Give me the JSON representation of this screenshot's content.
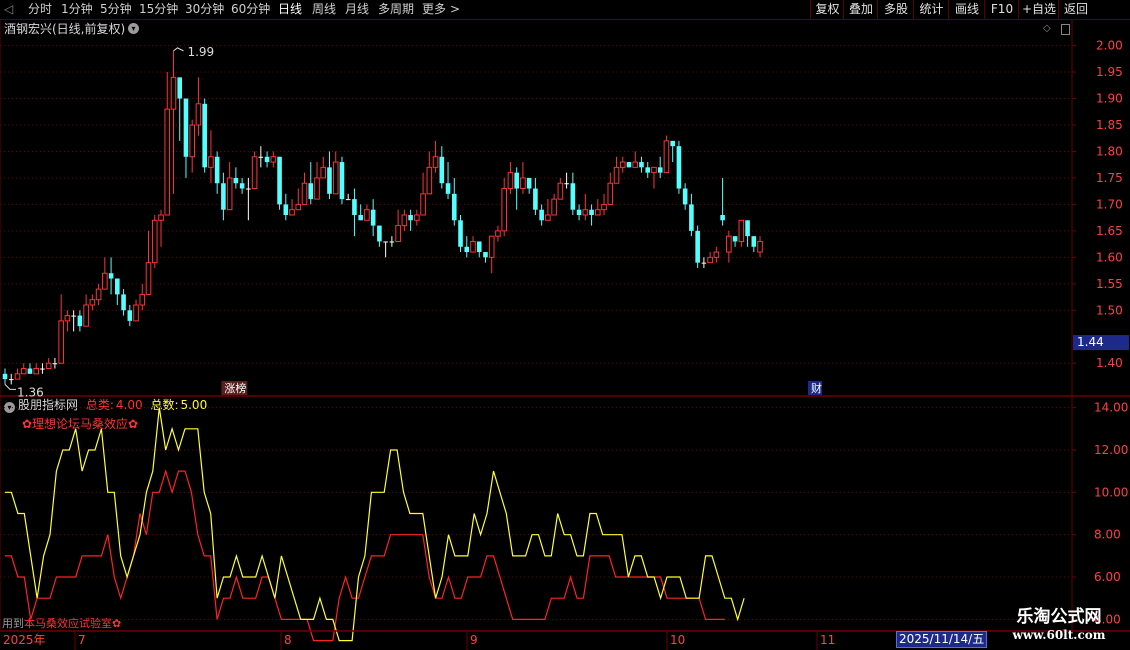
{
  "toolbar": {
    "periods": [
      "分时",
      "1分钟",
      "5分钟",
      "15分钟",
      "30分钟",
      "60分钟",
      "日线",
      "周线",
      "月线",
      "多周期",
      "更多"
    ],
    "active_period": "日线",
    "more_arrow": ">",
    "right_buttons": [
      "复权",
      "叠加",
      "多股",
      "统计",
      "画线",
      "F10",
      "+自选",
      "返回"
    ]
  },
  "main_chart": {
    "title": "酒钢宏兴(日线,前复权)",
    "high_label": "1.99",
    "low_label": "1.36",
    "current_price": "1.44",
    "y_ticks": [
      "2.00",
      "1.95",
      "1.90",
      "1.85",
      "1.80",
      "1.75",
      "1.70",
      "1.65",
      "1.60",
      "1.55",
      "1.50",
      "1.40"
    ],
    "markers": [
      {
        "label": "涨榜"
      },
      {
        "label": "财"
      }
    ],
    "colors": {
      "up": "#ff3333",
      "down": "#54ffff",
      "flat": "#ffffff",
      "grid": "#6e0000"
    }
  },
  "indicator": {
    "name": "股朋指标网",
    "label1": "总类:",
    "value1": "4.00",
    "label2": "总数:",
    "value2": "5.00",
    "caption": "✿理想论坛马桑效应✿",
    "y_ticks": [
      "14.00",
      "12.00",
      "10.00",
      "8.00",
      "6.00",
      "4.00"
    ],
    "colors": {
      "yellow": "#ffff33",
      "red": "#ff2222"
    }
  },
  "footer": {
    "bottom_left_gray": "用到",
    "bottom_left_red": "本马桑效应试验室✿",
    "year_label": "2025年",
    "month_labels": [
      "7",
      "8",
      "9",
      "10",
      "11"
    ],
    "date_box": "2025/11/14/五"
  },
  "watermark": {
    "title": "乐淘公式网",
    "url": "www.60lt.com"
  },
  "chart_data": [
    {
      "type": "candlestick",
      "title": "酒钢宏兴(日线,前复权)",
      "ylim": [
        1.34,
        2.02
      ],
      "annotations": {
        "high": 1.99,
        "low": 1.36,
        "last": 1.44
      },
      "candles": [
        [
          1.38,
          1.37,
          1.39,
          1.36
        ],
        [
          1.37,
          1.37,
          1.38,
          1.36
        ],
        [
          1.37,
          1.38,
          1.39,
          1.37
        ],
        [
          1.38,
          1.39,
          1.4,
          1.38
        ],
        [
          1.39,
          1.38,
          1.4,
          1.38
        ],
        [
          1.38,
          1.39,
          1.4,
          1.38
        ],
        [
          1.39,
          1.39,
          1.4,
          1.38
        ],
        [
          1.39,
          1.4,
          1.41,
          1.39
        ],
        [
          1.4,
          1.4,
          1.41,
          1.39
        ],
        [
          1.4,
          1.48,
          1.53,
          1.4
        ],
        [
          1.48,
          1.49,
          1.5,
          1.46
        ],
        [
          1.49,
          1.49,
          1.5,
          1.46
        ],
        [
          1.49,
          1.47,
          1.5,
          1.46
        ],
        [
          1.47,
          1.51,
          1.53,
          1.47
        ],
        [
          1.51,
          1.52,
          1.53,
          1.5
        ],
        [
          1.52,
          1.54,
          1.55,
          1.51
        ],
        [
          1.54,
          1.57,
          1.6,
          1.54
        ],
        [
          1.57,
          1.56,
          1.6,
          1.53
        ],
        [
          1.56,
          1.53,
          1.56,
          1.51
        ],
        [
          1.53,
          1.5,
          1.54,
          1.49
        ],
        [
          1.5,
          1.48,
          1.51,
          1.47
        ],
        [
          1.48,
          1.51,
          1.52,
          1.48
        ],
        [
          1.51,
          1.53,
          1.55,
          1.5
        ],
        [
          1.53,
          1.59,
          1.65,
          1.53
        ],
        [
          1.59,
          1.67,
          1.68,
          1.58
        ],
        [
          1.67,
          1.68,
          1.69,
          1.62
        ],
        [
          1.68,
          1.88,
          1.95,
          1.68
        ],
        [
          1.88,
          1.94,
          1.99,
          1.72
        ],
        [
          1.94,
          1.9,
          1.92,
          1.82
        ],
        [
          1.9,
          1.79,
          1.85,
          1.75
        ],
        [
          1.79,
          1.85,
          1.86,
          1.76
        ],
        [
          1.85,
          1.89,
          1.94,
          1.83
        ],
        [
          1.89,
          1.77,
          1.9,
          1.76
        ],
        [
          1.77,
          1.79,
          1.84,
          1.74
        ],
        [
          1.79,
          1.74,
          1.8,
          1.72
        ],
        [
          1.74,
          1.69,
          1.76,
          1.67
        ],
        [
          1.69,
          1.75,
          1.78,
          1.69
        ],
        [
          1.75,
          1.74,
          1.77,
          1.73
        ],
        [
          1.74,
          1.73,
          1.75,
          1.72
        ],
        [
          1.73,
          1.73,
          1.75,
          1.67
        ],
        [
          1.73,
          1.79,
          1.8,
          1.73
        ],
        [
          1.79,
          1.79,
          1.81,
          1.77
        ],
        [
          1.79,
          1.78,
          1.8,
          1.77
        ],
        [
          1.78,
          1.79,
          1.8,
          1.77
        ],
        [
          1.79,
          1.7,
          1.79,
          1.69
        ],
        [
          1.7,
          1.68,
          1.72,
          1.67
        ],
        [
          1.68,
          1.69,
          1.71,
          1.68
        ],
        [
          1.69,
          1.7,
          1.73,
          1.69
        ],
        [
          1.7,
          1.74,
          1.76,
          1.7
        ],
        [
          1.74,
          1.71,
          1.78,
          1.7
        ],
        [
          1.71,
          1.75,
          1.78,
          1.71
        ],
        [
          1.75,
          1.77,
          1.79,
          1.75
        ],
        [
          1.77,
          1.72,
          1.8,
          1.71
        ],
        [
          1.72,
          1.78,
          1.8,
          1.72
        ],
        [
          1.78,
          1.71,
          1.79,
          1.7
        ],
        [
          1.71,
          1.71,
          1.72,
          1.71
        ],
        [
          1.71,
          1.68,
          1.73,
          1.64
        ],
        [
          1.68,
          1.67,
          1.7,
          1.67
        ],
        [
          1.67,
          1.69,
          1.7,
          1.68
        ],
        [
          1.69,
          1.66,
          1.71,
          1.64
        ],
        [
          1.66,
          1.63,
          1.66,
          1.62
        ],
        [
          1.63,
          1.63,
          1.63,
          1.6
        ],
        [
          1.63,
          1.63,
          1.64,
          1.62
        ],
        [
          1.63,
          1.66,
          1.69,
          1.63
        ],
        [
          1.66,
          1.68,
          1.69,
          1.65
        ],
        [
          1.68,
          1.67,
          1.69,
          1.65
        ],
        [
          1.67,
          1.68,
          1.69,
          1.66
        ],
        [
          1.68,
          1.72,
          1.76,
          1.68
        ],
        [
          1.72,
          1.77,
          1.8,
          1.72
        ],
        [
          1.77,
          1.79,
          1.82,
          1.76
        ],
        [
          1.79,
          1.74,
          1.81,
          1.73
        ],
        [
          1.74,
          1.72,
          1.78,
          1.71
        ],
        [
          1.72,
          1.67,
          1.75,
          1.66
        ],
        [
          1.67,
          1.62,
          1.68,
          1.61
        ],
        [
          1.62,
          1.61,
          1.64,
          1.6
        ],
        [
          1.61,
          1.63,
          1.64,
          1.61
        ],
        [
          1.63,
          1.61,
          1.63,
          1.6
        ],
        [
          1.61,
          1.6,
          1.61,
          1.59
        ],
        [
          1.6,
          1.64,
          1.64,
          1.57
        ],
        [
          1.64,
          1.65,
          1.66,
          1.63
        ],
        [
          1.65,
          1.73,
          1.75,
          1.64
        ],
        [
          1.73,
          1.76,
          1.78,
          1.72
        ],
        [
          1.76,
          1.73,
          1.77,
          1.69
        ],
        [
          1.73,
          1.75,
          1.78,
          1.72
        ],
        [
          1.75,
          1.73,
          1.75,
          1.72
        ],
        [
          1.73,
          1.69,
          1.75,
          1.68
        ],
        [
          1.69,
          1.67,
          1.7,
          1.66
        ],
        [
          1.67,
          1.68,
          1.71,
          1.67
        ],
        [
          1.68,
          1.71,
          1.72,
          1.68
        ],
        [
          1.71,
          1.74,
          1.75,
          1.71
        ],
        [
          1.74,
          1.74,
          1.76,
          1.73
        ],
        [
          1.74,
          1.69,
          1.76,
          1.68
        ],
        [
          1.69,
          1.68,
          1.7,
          1.67
        ],
        [
          1.68,
          1.69,
          1.72,
          1.67
        ],
        [
          1.69,
          1.68,
          1.7,
          1.66
        ],
        [
          1.68,
          1.69,
          1.71,
          1.68
        ],
        [
          1.69,
          1.7,
          1.72,
          1.68
        ],
        [
          1.7,
          1.74,
          1.76,
          1.7
        ],
        [
          1.74,
          1.77,
          1.79,
          1.74
        ],
        [
          1.77,
          1.78,
          1.79,
          1.76
        ],
        [
          1.78,
          1.77,
          1.78,
          1.77
        ],
        [
          1.77,
          1.78,
          1.8,
          1.77
        ],
        [
          1.78,
          1.77,
          1.79,
          1.76
        ],
        [
          1.77,
          1.76,
          1.78,
          1.75
        ],
        [
          1.76,
          1.77,
          1.77,
          1.73
        ],
        [
          1.77,
          1.76,
          1.79,
          1.75
        ],
        [
          1.76,
          1.82,
          1.83,
          1.76
        ],
        [
          1.82,
          1.81,
          1.82,
          1.78
        ],
        [
          1.81,
          1.73,
          1.82,
          1.72
        ],
        [
          1.73,
          1.7,
          1.74,
          1.69
        ],
        [
          1.7,
          1.65,
          1.72,
          1.64
        ],
        [
          1.65,
          1.59,
          1.66,
          1.58
        ],
        [
          1.59,
          1.59,
          1.6,
          1.58
        ],
        [
          1.59,
          1.6,
          1.61,
          1.59
        ],
        [
          1.6,
          1.61,
          1.62,
          1.59
        ],
        [
          1.68,
          1.67,
          1.75,
          1.66
        ],
        [
          1.61,
          1.64,
          1.65,
          1.59
        ],
        [
          1.64,
          1.63,
          1.64,
          1.62
        ],
        [
          1.63,
          1.67,
          1.67,
          1.62
        ],
        [
          1.67,
          1.64,
          1.67,
          1.62
        ],
        [
          1.64,
          1.62,
          1.64,
          1.61
        ],
        [
          1.61,
          1.63,
          1.64,
          1.6
        ]
      ]
    },
    {
      "type": "line",
      "title": "股朋指标网",
      "ylim": [
        3.5,
        14.5
      ],
      "series": [
        {
          "name": "总类",
          "color": "#ff2222",
          "values": [
            7,
            7,
            6,
            6,
            4,
            5,
            5,
            5,
            6,
            6,
            6,
            6,
            7,
            7,
            7,
            7,
            8,
            6,
            5,
            6,
            7,
            9,
            8,
            10,
            10,
            11,
            10,
            11,
            11,
            10,
            8,
            7,
            7,
            4,
            5,
            5,
            6,
            5,
            5,
            5,
            6,
            6,
            5,
            4,
            4,
            4,
            4,
            4,
            3,
            3,
            3,
            3,
            5,
            6,
            5,
            5,
            6,
            7,
            7,
            7,
            8,
            8,
            8,
            8,
            8,
            8,
            6,
            5,
            5,
            6,
            5,
            5,
            6,
            6,
            6,
            7,
            7,
            6,
            5,
            4,
            4,
            4,
            4,
            4,
            4,
            5,
            5,
            5,
            6,
            5,
            5,
            7,
            7,
            7,
            7,
            6,
            6,
            6,
            6,
            6,
            6,
            6,
            6,
            5,
            5,
            5,
            5,
            5,
            5,
            4,
            4,
            4,
            4
          ]
        },
        {
          "name": "总数",
          "color": "#ffff33",
          "values": [
            10,
            10,
            9,
            9,
            7,
            5,
            7,
            8,
            11,
            12,
            12,
            13,
            11,
            12,
            12,
            13,
            10,
            10,
            7,
            6,
            7,
            8,
            10,
            11,
            14,
            12,
            13,
            12,
            13,
            13,
            13,
            10,
            9,
            5,
            6,
            6,
            7,
            6,
            6,
            6,
            7,
            6,
            5,
            7,
            6,
            5,
            4,
            4,
            4,
            5,
            4,
            4,
            3,
            3,
            3,
            6,
            7,
            10,
            10,
            10,
            12,
            12,
            10,
            9,
            9,
            9,
            7,
            5,
            6,
            8,
            7,
            7,
            7,
            9,
            8,
            9,
            11,
            10,
            9,
            7,
            7,
            7,
            8,
            8,
            7,
            7,
            9,
            8,
            8,
            7,
            7,
            9,
            9,
            8,
            8,
            8,
            8,
            6,
            7,
            7,
            6,
            6,
            5,
            6,
            6,
            6,
            5,
            5,
            5,
            7,
            7,
            6,
            5,
            5,
            4,
            5
          ]
        }
      ]
    }
  ]
}
